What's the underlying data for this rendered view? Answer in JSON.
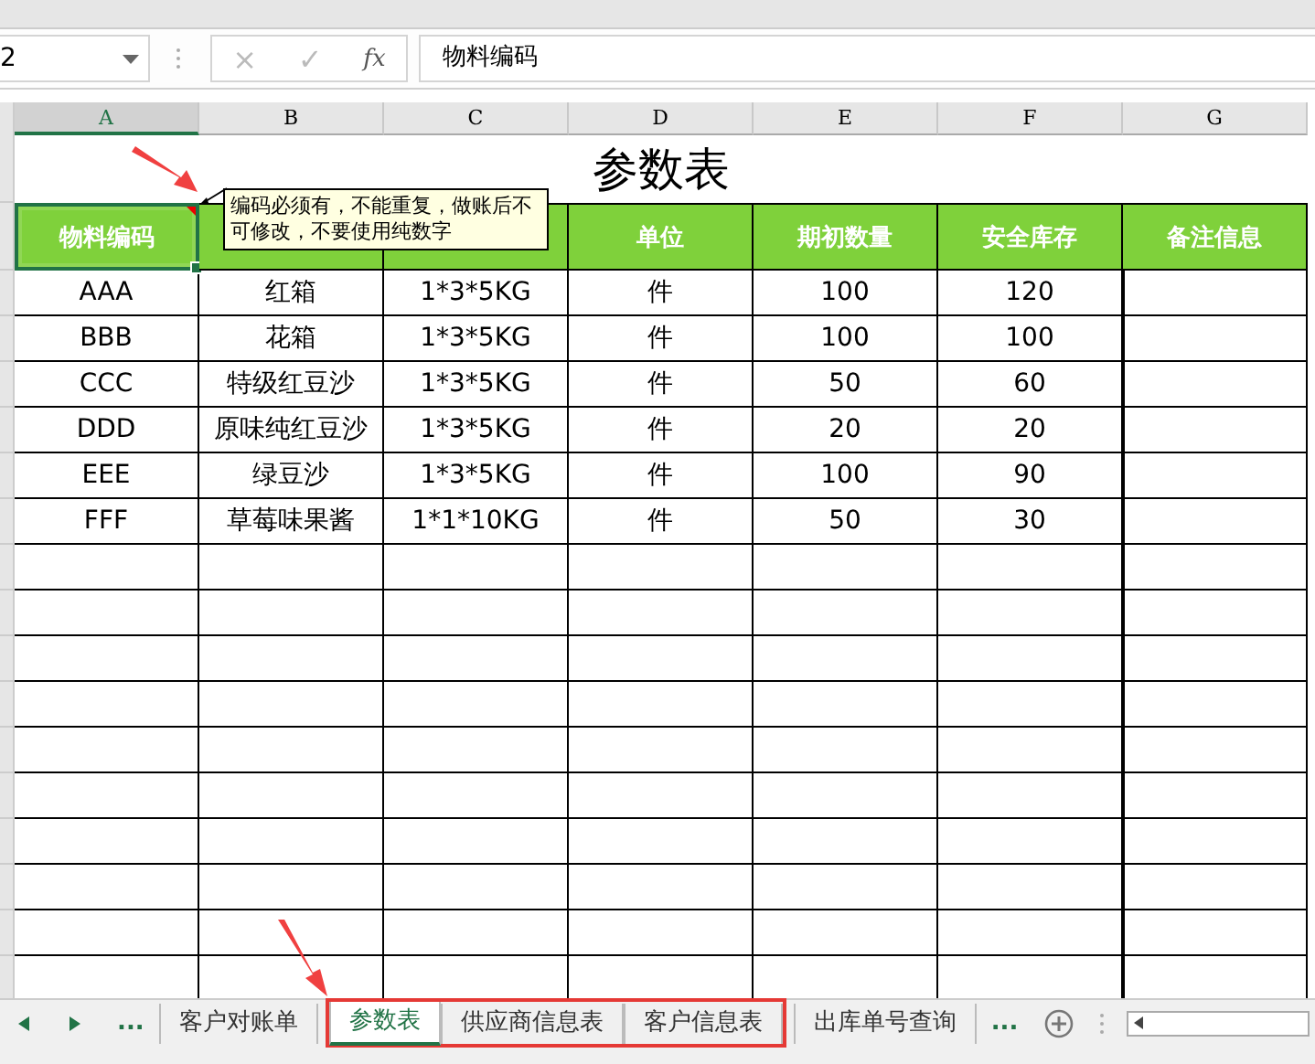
{
  "name_box": {
    "value": "2"
  },
  "formula_bar": {
    "buttons": [
      "×",
      "✓",
      "fx"
    ],
    "value": "物料编码"
  },
  "columns": [
    {
      "label": "A",
      "selected": true
    },
    {
      "label": "B",
      "selected": false
    },
    {
      "label": "C",
      "selected": false
    },
    {
      "label": "D",
      "selected": false
    },
    {
      "label": "E",
      "selected": false
    },
    {
      "label": "F",
      "selected": false
    },
    {
      "label": "G",
      "selected": false
    }
  ],
  "title": "参数表",
  "header": [
    {
      "text": "物料编码",
      "selected": true,
      "comment": true
    },
    {
      "selected": false
    },
    {
      "selected": false
    },
    {
      "text": "单位",
      "selected": false
    },
    {
      "text": "期初数量",
      "selected": false
    },
    {
      "text": "安全库存",
      "selected": false
    },
    {
      "text": "备注信息",
      "selected": false
    }
  ],
  "comment": {
    "text": "编码必须有，不能重复，做账后不可修改，不要使用纯数字"
  },
  "rows": [
    [
      "AAA",
      "红箱",
      "1*3*5KG",
      "件",
      "100",
      "120",
      ""
    ],
    [
      "BBB",
      "花箱",
      "1*3*5KG",
      "件",
      "100",
      "100",
      ""
    ],
    [
      "CCC",
      "特级红豆沙",
      "1*3*5KG",
      "件",
      "50",
      "60",
      ""
    ],
    [
      "DDD",
      "原味纯红豆沙",
      "1*3*5KG",
      "件",
      "20",
      "20",
      ""
    ],
    [
      "EEE",
      "绿豆沙",
      "1*3*5KG",
      "件",
      "100",
      "90",
      ""
    ],
    [
      "FFF",
      "草莓味果酱",
      "1*1*10KG",
      "件",
      "50",
      "30",
      ""
    ]
  ],
  "sheet_tabs": {
    "more_left": "...",
    "more_right": "...",
    "tabs": [
      {
        "label": "客户对账单",
        "selected": false,
        "boxed": false
      },
      {
        "label": "参数表",
        "selected": true,
        "boxed": true
      },
      {
        "label": "供应商信息表",
        "selected": false,
        "boxed": true
      },
      {
        "label": "客户信息表",
        "selected": false,
        "boxed": true
      },
      {
        "label": "出库单号查询",
        "selected": false,
        "boxed": false
      }
    ]
  }
}
